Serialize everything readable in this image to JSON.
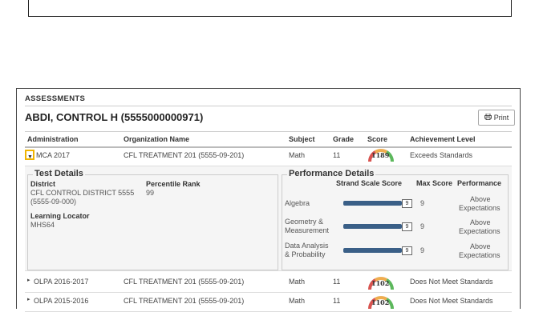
{
  "section_title": "ASSESSMENTS",
  "student_name": "ABDI, CONTROL H (5555000000971)",
  "print_label": "Print",
  "columns": [
    "Administration",
    "Organization Name",
    "Subject",
    "Grade",
    "Score",
    "Achievement Level"
  ],
  "rows": [
    {
      "administration": "MCA 2017",
      "organization": "CFL TREATMENT 201 (5555-09-201)",
      "subject": "Math",
      "grade": "11",
      "score": "1189",
      "achievement": "Exceeds Standards",
      "gauge_fill": 0.85
    },
    {
      "administration": "OLPA 2016-2017",
      "organization": "CFL TREATMENT 201 (5555-09-201)",
      "subject": "Math",
      "grade": "11",
      "score": "1102",
      "achievement": "Does Not Meet Standards",
      "gauge_fill": 0.4
    },
    {
      "administration": "OLPA 2015-2016",
      "organization": "CFL TREATMENT 201 (5555-09-201)",
      "subject": "Math",
      "grade": "11",
      "score": "1102",
      "achievement": "Does Not Meet Standards",
      "gauge_fill": 0.4
    }
  ],
  "test_details": {
    "legend": "Test Details",
    "district_label": "District",
    "district_line1": "CFL CONTROL DISTRICT 5555",
    "district_line2": "(5555-09-000)",
    "percentile_label": "Percentile Rank",
    "percentile_value": "99",
    "locator_label": "Learning Locator",
    "locator_value": "MHS64"
  },
  "performance_details": {
    "legend": "Performance Details",
    "headers": [
      "Strand Scale Score",
      "Max Score",
      "Performance"
    ],
    "strands": [
      {
        "name_line1": "Algebra",
        "name_line2": "",
        "scale": "9",
        "max": "9",
        "perf_line1": "Above",
        "perf_line2": "Expectations",
        "fill": 1.0
      },
      {
        "name_line1": "Geometry &",
        "name_line2": "Measurement",
        "scale": "9",
        "max": "9",
        "perf_line1": "Above",
        "perf_line2": "Expectations",
        "fill": 1.0
      },
      {
        "name_line1": "Data Analysis",
        "name_line2": "& Probability",
        "scale": "9",
        "max": "9",
        "perf_line1": "Above",
        "perf_line2": "Expectations",
        "fill": 1.0
      }
    ]
  },
  "colors": {
    "accent_bar": "#3a5f87",
    "toggle_highlight": "#f0b400"
  },
  "icons": {
    "print": "printer-icon",
    "toggle": "caret-down-icon",
    "row_toggle": "caret-right-icon"
  }
}
